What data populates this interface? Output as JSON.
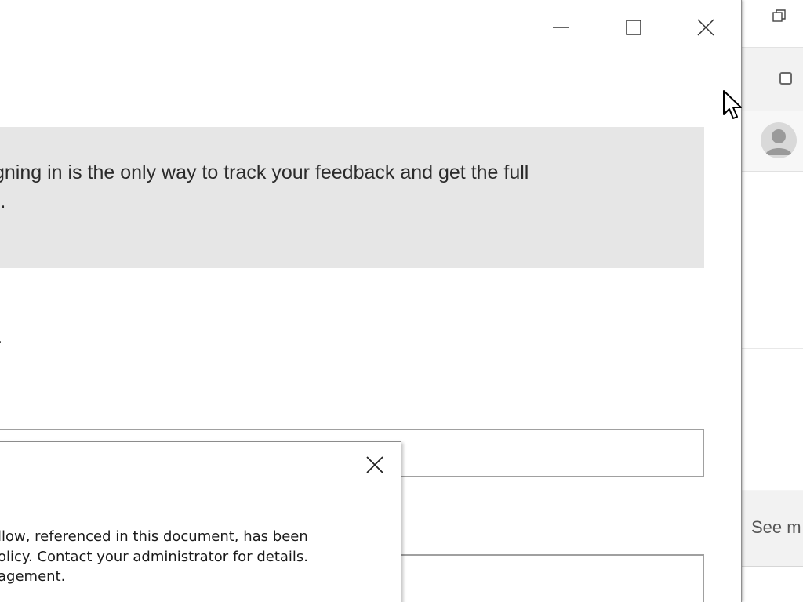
{
  "main_window": {
    "banner_text": "gning in is the only way to track your feedback and get the full\n).",
    "stray_char": ".",
    "controls": {
      "minimize_label": "Minimize",
      "maximize_label": "Maximize",
      "close_label": "Close"
    }
  },
  "dialog": {
    "message_lines": [
      "llow, referenced in this document, has been",
      "olicy. Contact your administrator for details.",
      "agement."
    ],
    "close_label": "Close"
  },
  "background_window": {
    "footer_link": "See m"
  },
  "colors": {
    "banner_bg": "#e6e6e6",
    "window_bg": "#ffffff",
    "border": "#a0a0a0"
  }
}
